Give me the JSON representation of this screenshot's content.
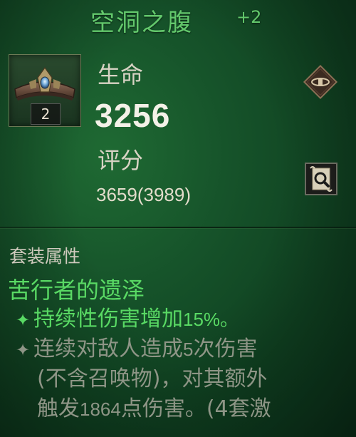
{
  "item": {
    "name": "空洞之腹",
    "upgrade": "+2",
    "count": "2",
    "stat_label": "生命",
    "stat_value": "3256",
    "score_label": "评分",
    "score_value": "3659(3989)"
  },
  "set": {
    "header": "套装属性",
    "name": "苦行者的遗泽",
    "bonus_active_text": "持续性伤害增加",
    "bonus_active_value": "15%。",
    "bonus_inactive_line1_a": "连续对敌人造成",
    "bonus_inactive_line1_num": "5",
    "bonus_inactive_line1_b": "次伤害",
    "bonus_inactive_line2": "(不含召唤物)，对其额外",
    "bonus_inactive_line3_a": "触发",
    "bonus_inactive_line3_num": "1864",
    "bonus_inactive_line3_b": "点伤害。(4套激"
  },
  "colors": {
    "set_active": "#59d964",
    "set_inactive": "#8e9586",
    "title": "#63c86c",
    "background": "#16532a"
  },
  "icons": {
    "item": "belt-icon",
    "bullet": "diamond-bullet-icon",
    "compare": "belt-compare-icon",
    "inspect": "magnifier-scroll-icon"
  }
}
